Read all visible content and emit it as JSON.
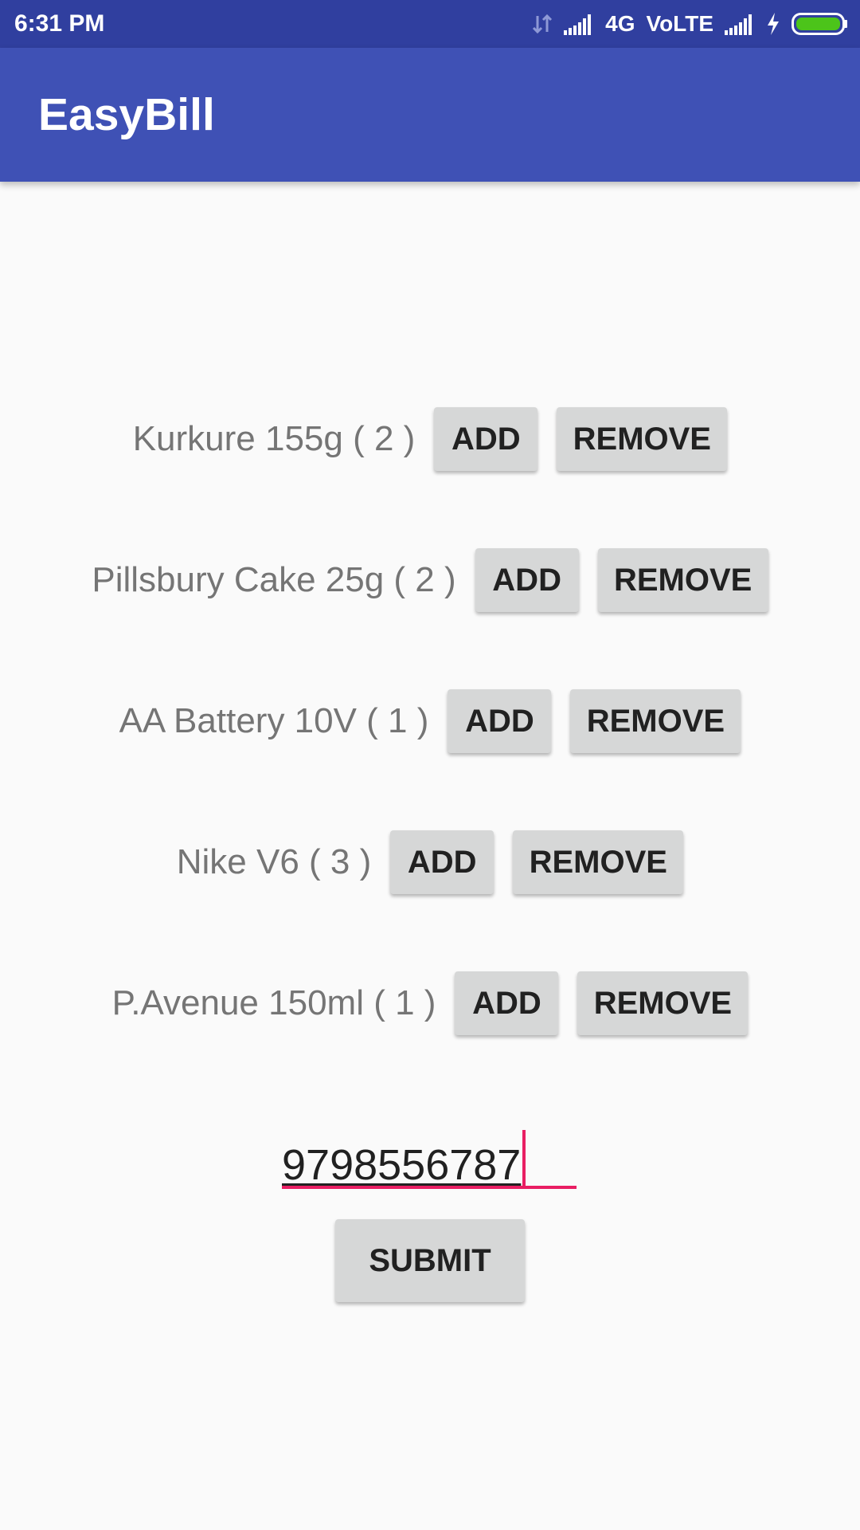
{
  "status_bar": {
    "time": "6:31 PM",
    "network": "4G",
    "volte": "VoLTE",
    "battery_color": "#4CC41A"
  },
  "app_bar": {
    "title": "EasyBill",
    "color": "#3F51B5"
  },
  "items": [
    {
      "label": "Kurkure 155g ( 2 )",
      "add_label": "ADD",
      "remove_label": "REMOVE"
    },
    {
      "label": "Pillsbury Cake 25g ( 2 )",
      "add_label": "ADD",
      "remove_label": "REMOVE"
    },
    {
      "label": "AA Battery 10V ( 1 )",
      "add_label": "ADD",
      "remove_label": "REMOVE"
    },
    {
      "label": "Nike V6 ( 3 )",
      "add_label": "ADD",
      "remove_label": "REMOVE"
    },
    {
      "label": "P.Avenue 150ml ( 1 )",
      "add_label": "ADD",
      "remove_label": "REMOVE"
    }
  ],
  "phone": {
    "value": "9798556787",
    "accent_color": "#E91E63"
  },
  "submit_label": "SUBMIT"
}
